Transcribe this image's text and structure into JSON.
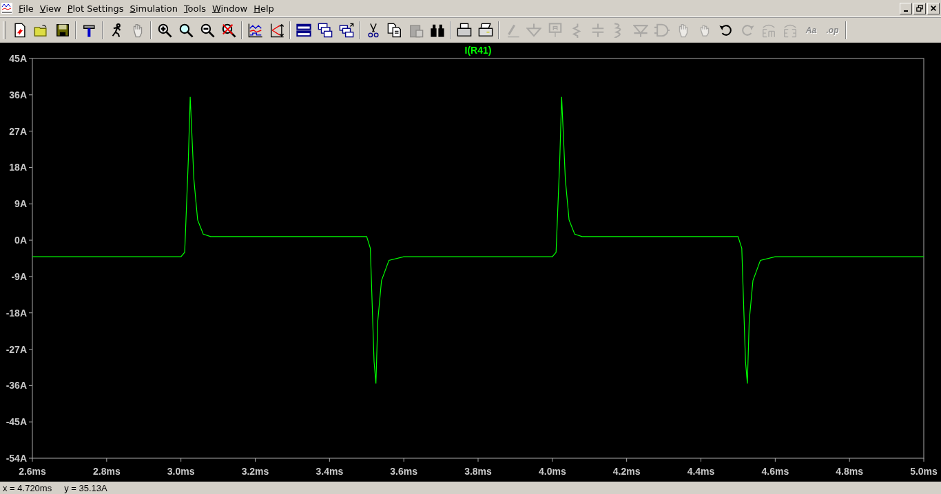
{
  "menu": [
    "File",
    "View",
    "Plot Settings",
    "Simulation",
    "Tools",
    "Window",
    "Help"
  ],
  "toolbar": {
    "groups": [
      [
        {
          "disabled": false
        },
        {
          "disabled": false
        },
        {
          "disabled": false
        }
      ],
      [
        {
          "disabled": false
        }
      ],
      [
        {
          "disabled": false
        },
        {
          "disabled": true
        }
      ],
      [
        {
          "disabled": false
        },
        {
          "disabled": false
        },
        {
          "disabled": false
        },
        {
          "disabled": false
        }
      ],
      [
        {
          "disabled": false
        },
        {
          "disabled": false
        }
      ],
      [
        {
          "disabled": false
        },
        {
          "disabled": false
        },
        {
          "disabled": false
        }
      ],
      [
        {
          "disabled": false
        },
        {
          "disabled": false
        },
        {
          "disabled": true
        },
        {
          "disabled": false
        }
      ],
      [
        {
          "disabled": false
        },
        {
          "disabled": false
        }
      ],
      [
        {
          "disabled": true
        },
        {
          "disabled": true
        },
        {
          "disabled": true
        },
        {
          "disabled": true
        },
        {
          "disabled": true
        },
        {
          "disabled": true
        },
        {
          "disabled": true
        },
        {
          "disabled": true
        },
        {
          "disabled": true
        },
        {
          "disabled": true
        },
        {
          "disabled": false
        },
        {
          "disabled": true
        },
        {
          "disabled": true
        },
        {
          "disabled": true
        },
        {
          "disabled": true,
          "label": "Aa"
        },
        {
          "disabled": true,
          "label": ".op"
        }
      ]
    ]
  },
  "plot": {
    "chart_data": {
      "type": "line",
      "xlim": [
        2.6,
        5.0
      ],
      "ylim": [
        -54,
        45
      ],
      "xticks": [
        {
          "value": 2.6,
          "label": "2.6ms"
        },
        {
          "value": 2.8,
          "label": "2.8ms"
        },
        {
          "value": 3.0,
          "label": "3.0ms"
        },
        {
          "value": 3.2,
          "label": "3.2ms"
        },
        {
          "value": 3.4,
          "label": "3.4ms"
        },
        {
          "value": 3.6,
          "label": "3.6ms"
        },
        {
          "value": 3.8,
          "label": "3.8ms"
        },
        {
          "value": 4.0,
          "label": "4.0ms"
        },
        {
          "value": 4.2,
          "label": "4.2ms"
        },
        {
          "value": 4.4,
          "label": "4.4ms"
        },
        {
          "value": 4.6,
          "label": "4.6ms"
        },
        {
          "value": 4.8,
          "label": "4.8ms"
        },
        {
          "value": 5.0,
          "label": "5.0ms"
        }
      ],
      "yticks": [
        {
          "value": 45,
          "label": "45A"
        },
        {
          "value": 36,
          "label": "36A"
        },
        {
          "value": 27,
          "label": "27A"
        },
        {
          "value": 18,
          "label": "18A"
        },
        {
          "value": 9,
          "label": "9A"
        },
        {
          "value": 0,
          "label": "0A"
        },
        {
          "value": -9,
          "label": "-9A"
        },
        {
          "value": -18,
          "label": "-18A"
        },
        {
          "value": -27,
          "label": "-27A"
        },
        {
          "value": -36,
          "label": "-36A"
        },
        {
          "value": -45,
          "label": "-45A"
        },
        {
          "value": -54,
          "label": "-54A"
        }
      ],
      "x": [
        2.6,
        3.0,
        3.01,
        3.02,
        3.025,
        3.035,
        3.045,
        3.06,
        3.08,
        3.5,
        3.51,
        3.52,
        3.525,
        3.53,
        3.54,
        3.56,
        3.6,
        4.0,
        4.01,
        4.02,
        4.025,
        4.035,
        4.045,
        4.06,
        4.08,
        4.5,
        4.51,
        4.52,
        4.525,
        4.53,
        4.54,
        4.56,
        4.6,
        5.0
      ],
      "series": [
        {
          "name": "I(R41)",
          "color": "#00ff00",
          "values": [
            -4.1,
            -4.1,
            -3,
            20,
            35.5,
            15,
            5,
            1.5,
            0.9,
            0.9,
            -2,
            -30,
            -35.5,
            -20,
            -10,
            -5,
            -4.1,
            -4.1,
            -3,
            20,
            35.5,
            15,
            5,
            1.5,
            0.9,
            0.9,
            -2,
            -30,
            -35.5,
            -20,
            -10,
            -5,
            -4.1,
            -4.1
          ]
        }
      ]
    }
  },
  "status_bar": {
    "x_reading": "x = 4.720ms",
    "y_reading": "y = 35.13A"
  }
}
